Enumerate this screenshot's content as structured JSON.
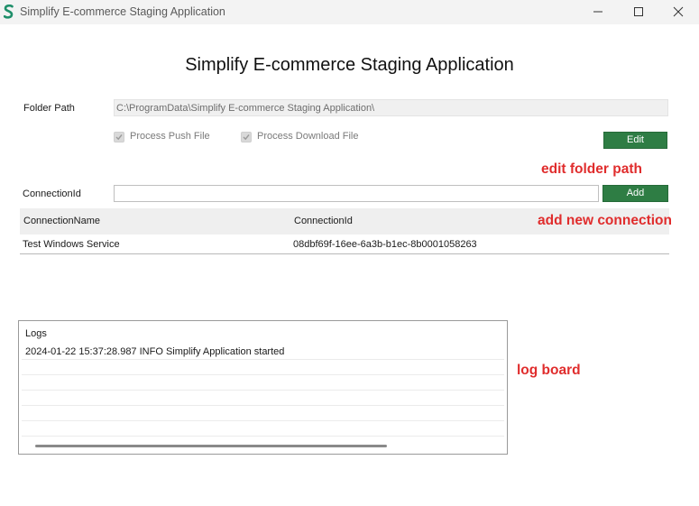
{
  "window": {
    "title": "Simplify E-commerce Staging Application"
  },
  "heading": "Simplify E-commerce Staging Application",
  "folder": {
    "label": "Folder Path",
    "path": "C:\\ProgramData\\Simplify E-commerce Staging Application\\",
    "process_push_label": "Process Push File",
    "process_push_checked": true,
    "process_download_label": "Process Download File",
    "process_download_checked": true,
    "edit_label": "Edit"
  },
  "connection": {
    "label": "ConnectionId",
    "value": "",
    "add_label": "Add"
  },
  "table": {
    "columns": [
      "ConnectionName",
      "ConnectionId"
    ],
    "rows": [
      [
        "Test Windows Service",
        "08dbf69f-16ee-6a3b-b1ec-8b0001058263"
      ]
    ]
  },
  "logs": {
    "heading": "Logs",
    "entries": [
      "2024-01-22 15:37:28.987 INFO Simplify Application started"
    ]
  },
  "annotations": {
    "edit": "edit folder path",
    "add": "add new connection",
    "log": "log board"
  },
  "colors": {
    "button_green": "#2e7d44",
    "annotation_red": "#e02d2d",
    "logo_teal": "#1f8f6a"
  }
}
